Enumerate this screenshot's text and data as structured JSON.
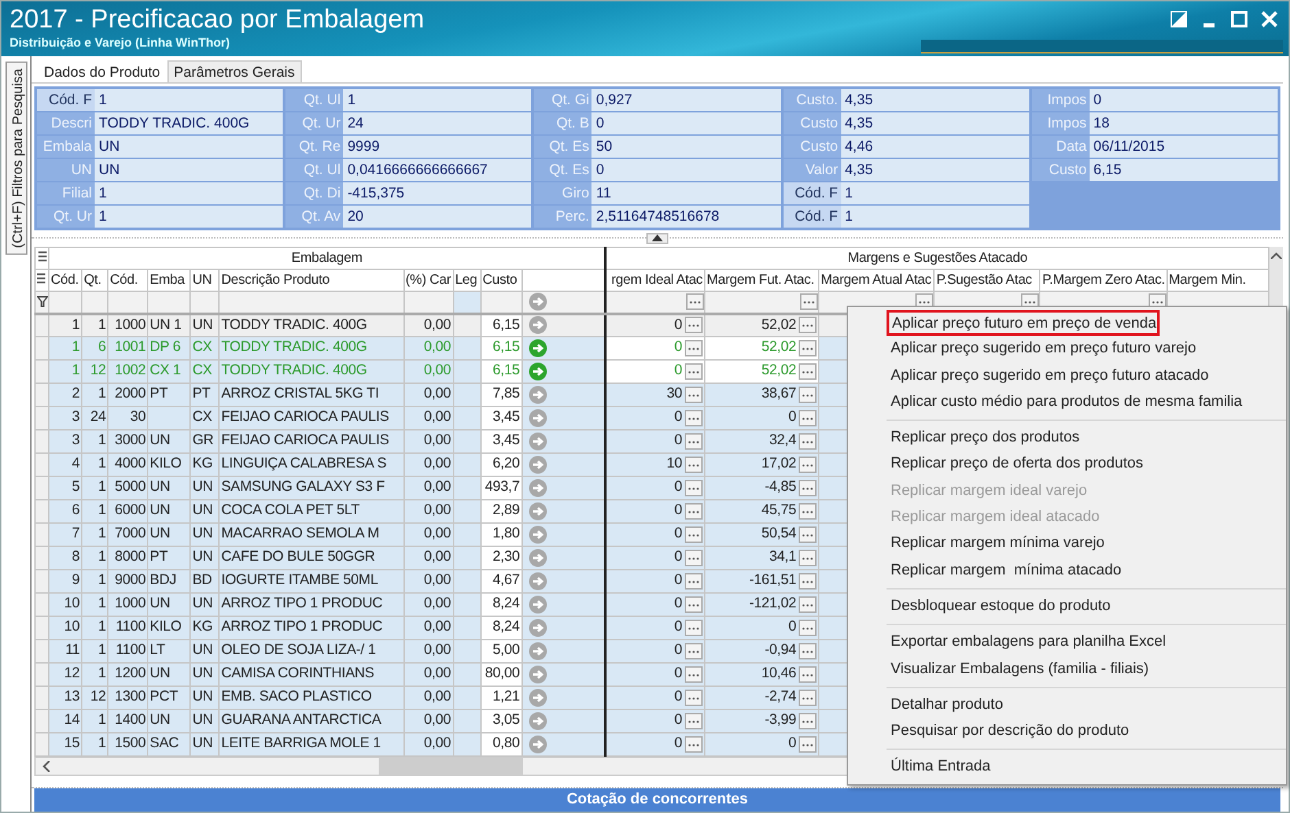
{
  "window": {
    "title": "2017 - Precificacao por Embalagem",
    "subtitle": "Distribuição e Varejo (Linha WinThor)"
  },
  "side_tab": {
    "label": "(Ctrl+F) Filtros para Pesquisa"
  },
  "tabs": [
    {
      "label": "Dados do Produto",
      "selected": true
    },
    {
      "label": "Parâmetros Gerais",
      "selected": false
    }
  ],
  "field_groups": [
    {
      "fields": [
        {
          "label": "Cód. F",
          "value": "1",
          "highlighted": true
        },
        {
          "label": "Descri",
          "value": "TODDY TRADIC. 400G",
          "highlighted": false
        },
        {
          "label": "Embala",
          "value": "UN",
          "highlighted": false
        },
        {
          "label": "UN",
          "value": "UN",
          "highlighted": false
        },
        {
          "label": "Filial",
          "value": "1",
          "highlighted": false
        },
        {
          "label": "Qt. Ur",
          "value": "1",
          "highlighted": false
        }
      ]
    },
    {
      "fields": [
        {
          "label": "Qt. Ul",
          "value": "1",
          "highlighted": false
        },
        {
          "label": "Qt. Ur",
          "value": "24",
          "highlighted": false
        },
        {
          "label": "Qt. Re",
          "value": "9999",
          "highlighted": false
        },
        {
          "label": "Qt. Ul",
          "value": "0,0416666666666667",
          "highlighted": false
        },
        {
          "label": "Qt. Di",
          "value": "-415,375",
          "highlighted": false
        },
        {
          "label": "Qt. Av",
          "value": "20",
          "highlighted": false
        }
      ]
    },
    {
      "fields": [
        {
          "label": "Qt. Gi",
          "value": "0,927",
          "highlighted": false
        },
        {
          "label": "Qt. B",
          "value": "0",
          "highlighted": false
        },
        {
          "label": "Qt. Es",
          "value": "50",
          "highlighted": false
        },
        {
          "label": "Qt. Es",
          "value": "0",
          "highlighted": false
        },
        {
          "label": "Giro",
          "value": "11",
          "highlighted": false
        },
        {
          "label": "Perc.",
          "value": "2,51164748516678",
          "highlighted": false
        }
      ]
    },
    {
      "fields": [
        {
          "label": "Custo.",
          "value": "4,35",
          "highlighted": false
        },
        {
          "label": "Custo",
          "value": "4,35",
          "highlighted": false
        },
        {
          "label": "Custo",
          "value": "4,46",
          "highlighted": false
        },
        {
          "label": "Valor",
          "value": "4,35",
          "highlighted": false
        },
        {
          "label": "Cód. F",
          "value": "1",
          "highlighted": true
        },
        {
          "label": "Cód. F",
          "value": "1",
          "highlighted": true
        }
      ]
    },
    {
      "fields": [
        {
          "label": "Impos",
          "value": "0",
          "highlighted": false
        },
        {
          "label": "Impos",
          "value": "18",
          "highlighted": false
        },
        {
          "label": "Data",
          "value": "06/11/2015",
          "highlighted": false
        },
        {
          "label": "Custo",
          "value": "6,15",
          "highlighted": false
        }
      ]
    }
  ],
  "grid": {
    "groups": [
      {
        "label": "Embalagem",
        "columns": [
          "Cód.",
          "Qt.",
          "Cód.",
          "Emba",
          "UN",
          "Descrição Produto",
          "(%) Car",
          "Leg",
          "Custo"
        ]
      },
      {
        "label": "Margens e Sugestões Atacado",
        "columns": [
          "rgem Ideal Atac",
          "Margem Fut. Atac.",
          "Margem Atual Atac",
          "P.Sugestão Atac",
          "P.Margem Zero Atac.",
          "Margem Min."
        ]
      }
    ],
    "rows": [
      {
        "cod": "1",
        "qt": "1",
        "cod_emb": "1000",
        "emba": "UN 1",
        "un": "UN",
        "descricao": "TODDY TRADIC. 400G",
        "perc": "0,00",
        "custo": "6,15",
        "margem_ideal": "0",
        "margem_fut": "52,02",
        "selected": true,
        "highlighted": false
      },
      {
        "cod": "1",
        "qt": "6",
        "cod_emb": "1001",
        "emba": "DP 6",
        "un": "CX",
        "descricao": "TODDY TRADIC. 400G",
        "perc": "0,00",
        "custo": "6,15",
        "margem_ideal": "0",
        "margem_fut": "52,02",
        "selected": false,
        "highlighted": true
      },
      {
        "cod": "1",
        "qt": "12",
        "cod_emb": "1002",
        "emba": "CX 1",
        "un": "CX",
        "descricao": "TODDY TRADIC. 400G",
        "perc": "0,00",
        "custo": "6,15",
        "margem_ideal": "0",
        "margem_fut": "52,02",
        "selected": false,
        "highlighted": true
      },
      {
        "cod": "2",
        "qt": "1",
        "cod_emb": "2000",
        "emba": "PT",
        "un": "PT",
        "descricao": "ARROZ CRISTAL 5KG TI",
        "perc": "0,00",
        "custo": "7,85",
        "margem_ideal": "30",
        "margem_fut": "38,67",
        "selected": false,
        "highlighted": false
      },
      {
        "cod": "3",
        "qt": "24",
        "cod_emb": "30",
        "un": "CX",
        "descricao": "FEIJAO CARIOCA PAULIS",
        "perc": "0,00",
        "custo": "3,45",
        "margem_ideal": "0",
        "margem_fut": "0",
        "selected": false,
        "highlighted": false
      },
      {
        "cod": "3",
        "qt": "1",
        "cod_emb": "3000",
        "emba": "UN",
        "un": "GR",
        "descricao": "FEIJAO CARIOCA PAULIS",
        "perc": "0,00",
        "custo": "3,45",
        "margem_ideal": "0",
        "margem_fut": "32,4",
        "selected": false,
        "highlighted": false
      },
      {
        "cod": "4",
        "qt": "1",
        "cod_emb": "4000",
        "emba": "KILO",
        "un": "KG",
        "descricao": "LINGUIÇA CALABRESA S",
        "perc": "0,00",
        "custo": "6,20",
        "margem_ideal": "10",
        "margem_fut": "17,02",
        "selected": false,
        "highlighted": false
      },
      {
        "cod": "5",
        "qt": "1",
        "cod_emb": "5000",
        "emba": "UN",
        "un": "UN",
        "descricao": "SAMSUNG GALAXY S3 F",
        "perc": "0,00",
        "custo": "493,7",
        "margem_ideal": "0",
        "margem_fut": "-4,85",
        "selected": false,
        "highlighted": false
      },
      {
        "cod": "6",
        "qt": "1",
        "cod_emb": "6000",
        "emba": "UN",
        "un": "UN",
        "descricao": "COCA COLA PET 5LT",
        "perc": "0,00",
        "custo": "2,89",
        "margem_ideal": "0",
        "margem_fut": "45,75",
        "selected": false,
        "highlighted": false
      },
      {
        "cod": "7",
        "qt": "1",
        "cod_emb": "7000",
        "emba": "UN",
        "un": "UN",
        "descricao": "MACARRAO SEMOLA M",
        "perc": "0,00",
        "custo": "1,80",
        "margem_ideal": "0",
        "margem_fut": "50,54",
        "selected": false,
        "highlighted": false
      },
      {
        "cod": "8",
        "qt": "1",
        "cod_emb": "8000",
        "emba": "PT",
        "un": "UN",
        "descricao": "CAFE DO BULE 50GGR",
        "perc": "0,00",
        "custo": "2,30",
        "margem_ideal": "0",
        "margem_fut": "34,1",
        "selected": false,
        "highlighted": false
      },
      {
        "cod": "9",
        "qt": "1",
        "cod_emb": "9000",
        "emba": "BDJ",
        "un": "BD",
        "descricao": "IOGURTE ITAMBE 50ML",
        "perc": "0,00",
        "custo": "4,67",
        "margem_ideal": "0",
        "margem_fut": "-161,51",
        "selected": false,
        "highlighted": false
      },
      {
        "cod": "10",
        "qt": "1",
        "cod_emb": "1000",
        "emba": "UN",
        "un": "UN",
        "descricao": "ARROZ TIPO 1 PRODUC",
        "perc": "0,00",
        "custo": "8,24",
        "margem_ideal": "0",
        "margem_fut": "-121,02",
        "selected": false,
        "highlighted": false
      },
      {
        "cod": "10",
        "qt": "1",
        "cod_emb": "1100",
        "emba": "KILO",
        "un": "KG",
        "descricao": "ARROZ TIPO 1 PRODUC",
        "perc": "0,00",
        "custo": "8,24",
        "margem_ideal": "0",
        "margem_fut": "0",
        "selected": false,
        "highlighted": false
      },
      {
        "cod": "11",
        "qt": "1",
        "cod_emb": "1100",
        "emba": "LT",
        "un": "UN",
        "descricao": "OLEO DE SOJA LIZA-/ 1",
        "perc": "0,00",
        "custo": "5,00",
        "margem_ideal": "0",
        "margem_fut": "-0,94",
        "selected": false,
        "highlighted": false
      },
      {
        "cod": "12",
        "qt": "1",
        "cod_emb": "1200",
        "emba": "UN",
        "un": "UN",
        "descricao": "CAMISA CORINTHIANS",
        "perc": "0,00",
        "custo": "80,00",
        "margem_ideal": "0",
        "margem_fut": "10,46",
        "selected": false,
        "highlighted": false
      },
      {
        "cod": "13",
        "qt": "12",
        "cod_emb": "1300",
        "emba": "PCT",
        "un": "UN",
        "descricao": "EMB. SACO PLASTICO",
        "perc": "0,00",
        "custo": "1,21",
        "margem_ideal": "0",
        "margem_fut": "-2,74",
        "selected": false,
        "highlighted": false
      },
      {
        "cod": "14",
        "qt": "1",
        "cod_emb": "1400",
        "emba": "UN",
        "un": "UN",
        "descricao": "GUARANA ANTARCTICA",
        "perc": "0,00",
        "custo": "3,05",
        "margem_ideal": "0",
        "margem_fut": "-3,99",
        "selected": false,
        "highlighted": false
      },
      {
        "cod": "15",
        "qt": "1",
        "cod_emb": "1500",
        "emba": "SAC",
        "un": "UN",
        "descricao": "LEITE BARRIGA MOLE 1",
        "perc": "0,00",
        "custo": "0,80",
        "margem_ideal": "0",
        "margem_fut": "0",
        "selected": false,
        "highlighted": false
      }
    ]
  },
  "context_menu": {
    "items": [
      {
        "kind": "item",
        "label": "Aplicar preço futuro em preço de venda",
        "selected": true,
        "disabled": false
      },
      {
        "kind": "item",
        "label": "Aplicar preço sugerido em preço futuro varejo",
        "selected": false,
        "disabled": false
      },
      {
        "kind": "item",
        "label": "Aplicar preço sugerido em preço futuro atacado",
        "selected": false,
        "disabled": false
      },
      {
        "kind": "item",
        "label": "Aplicar custo médio para produtos de mesma familia",
        "selected": false,
        "disabled": false
      },
      {
        "kind": "separator"
      },
      {
        "kind": "item",
        "label": "Replicar preço dos produtos",
        "selected": false,
        "disabled": false
      },
      {
        "kind": "item",
        "label": "Replicar preço de oferta dos produtos",
        "selected": false,
        "disabled": false
      },
      {
        "kind": "item",
        "label": "Replicar margem ideal varejo",
        "selected": false,
        "disabled": true
      },
      {
        "kind": "item",
        "label": "Replicar margem ideal atacado",
        "selected": false,
        "disabled": true
      },
      {
        "kind": "item",
        "label": "Replicar margem mínima varejo",
        "selected": false,
        "disabled": false
      },
      {
        "kind": "item",
        "label": "Replicar margem  mínima atacado",
        "selected": false,
        "disabled": false
      },
      {
        "kind": "separator"
      },
      {
        "kind": "item",
        "label": "Desbloquear estoque do produto",
        "selected": false,
        "disabled": false
      },
      {
        "kind": "separator"
      },
      {
        "kind": "item",
        "label": "Exportar embalagens para planilha Excel",
        "selected": false,
        "disabled": false
      },
      {
        "kind": "item",
        "label": "Visualizar Embalagens (familia - filiais)",
        "selected": false,
        "disabled": false
      },
      {
        "kind": "separator"
      },
      {
        "kind": "item",
        "label": "Detalhar produto",
        "selected": false,
        "disabled": false
      },
      {
        "kind": "item",
        "label": "Pesquisar por descrição do produto",
        "selected": false,
        "disabled": false
      },
      {
        "kind": "separator"
      },
      {
        "kind": "item",
        "label": "Última Entrada",
        "selected": false,
        "disabled": false
      }
    ]
  },
  "bottom_panel": {
    "title": "Cotação de concorrentes"
  }
}
